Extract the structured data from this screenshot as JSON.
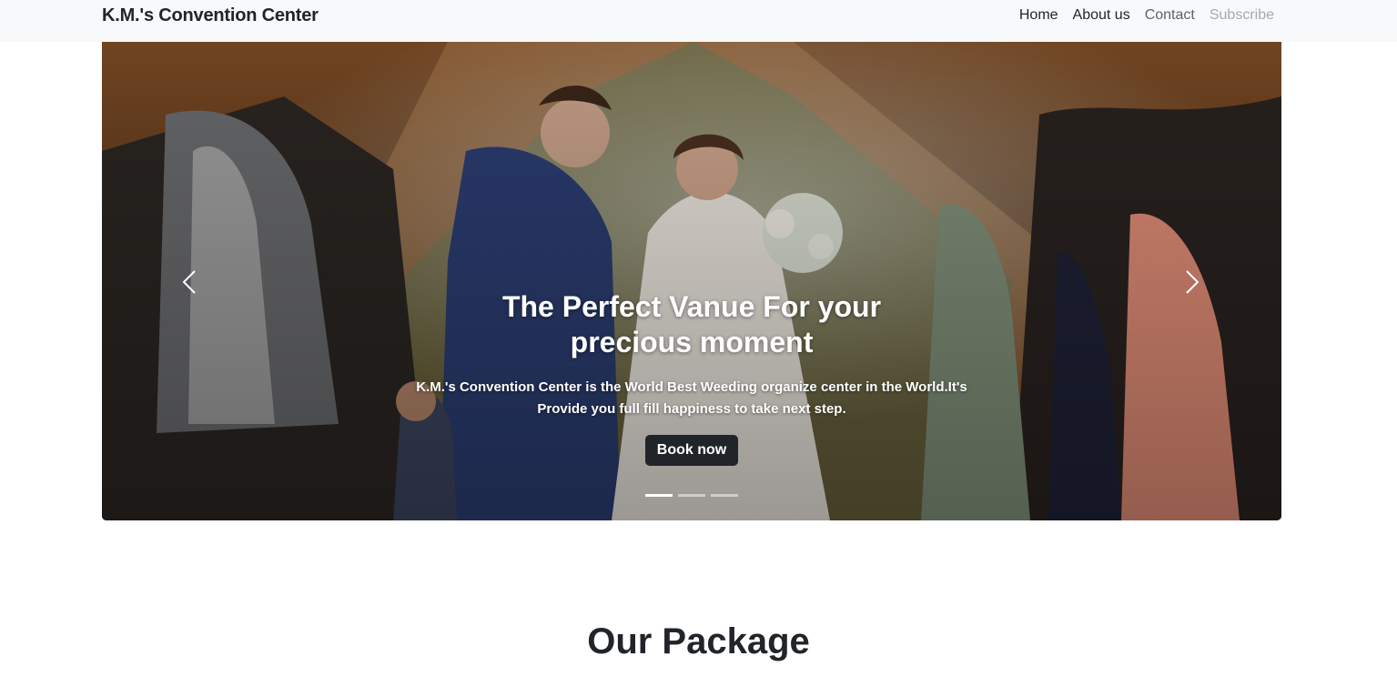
{
  "navbar": {
    "brand": "K.M.'s Convention Center",
    "links": [
      "Home",
      "About us",
      "Contact",
      "Subscribe"
    ]
  },
  "hero": {
    "title": "The Perfect Vanue For your precious moment",
    "description": "K.M.'s Convention Center is the World Best Weeding organize center in the World.It's Provide you full fill happiness to take next step.",
    "button": "Book now",
    "slides": 3,
    "active_slide": 1
  },
  "section": {
    "title": "Our Package"
  },
  "colors": {
    "navbar_bg": "#f8f9fa",
    "button_bg": "#212529",
    "text": "#212529"
  }
}
